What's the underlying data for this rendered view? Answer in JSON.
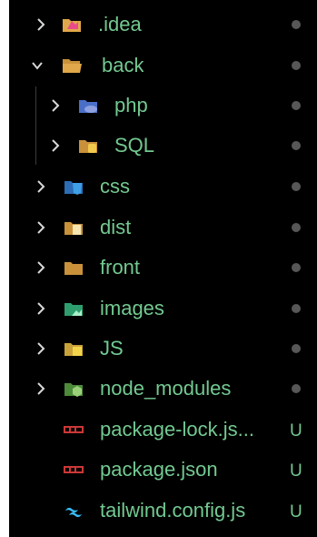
{
  "tree": {
    "items": [
      {
        "label": ".idea",
        "icon": "idea-folder-icon",
        "expand": "collapsed",
        "status": "dot"
      },
      {
        "label": "back",
        "icon": "folder-open-icon",
        "expand": "expanded",
        "status": "dot"
      },
      {
        "label": "php",
        "icon": "php-folder-icon",
        "expand": "collapsed",
        "status": "dot"
      },
      {
        "label": "SQL",
        "icon": "sql-folder-icon",
        "expand": "collapsed",
        "status": "dot"
      },
      {
        "label": "css",
        "icon": "css-folder-icon",
        "expand": "collapsed",
        "status": "dot"
      },
      {
        "label": "dist",
        "icon": "dist-folder-icon",
        "expand": "collapsed",
        "status": "dot"
      },
      {
        "label": "front",
        "icon": "folder-icon",
        "expand": "collapsed",
        "status": "dot"
      },
      {
        "label": "images",
        "icon": "images-folder-icon",
        "expand": "collapsed",
        "status": "dot"
      },
      {
        "label": "JS",
        "icon": "js-folder-icon",
        "expand": "collapsed",
        "status": "dot"
      },
      {
        "label": "node_modules",
        "icon": "node-folder-icon",
        "expand": "collapsed",
        "status": "dot"
      },
      {
        "label": "package-lock.js...",
        "icon": "npm-file-icon",
        "expand": "none",
        "status": "U"
      },
      {
        "label": "package.json",
        "icon": "npm-file-icon",
        "expand": "none",
        "status": "U"
      },
      {
        "label": "tailwind.config.js",
        "icon": "tailwind-file-icon",
        "expand": "none",
        "status": "U"
      }
    ]
  },
  "colors": {
    "background": "#000000",
    "untracked_text": "#73c991",
    "chevron": "#d8d8d8",
    "status_dot": "#9e9e9e"
  }
}
